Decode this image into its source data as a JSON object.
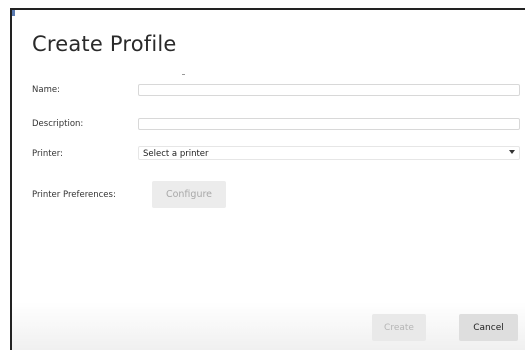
{
  "dialog": {
    "title": "Create Profile",
    "fields": {
      "name_label": "Name:",
      "name_value": "",
      "description_label": "Description:",
      "description_value": "",
      "printer_label": "Printer:",
      "printer_selected": "Select a printer",
      "preferences_label": "Printer Preferences:"
    },
    "buttons": {
      "configure": "Configure",
      "create": "Create",
      "cancel": "Cancel"
    }
  },
  "icons": {
    "printer_dropdown": "chevron-down-icon"
  }
}
